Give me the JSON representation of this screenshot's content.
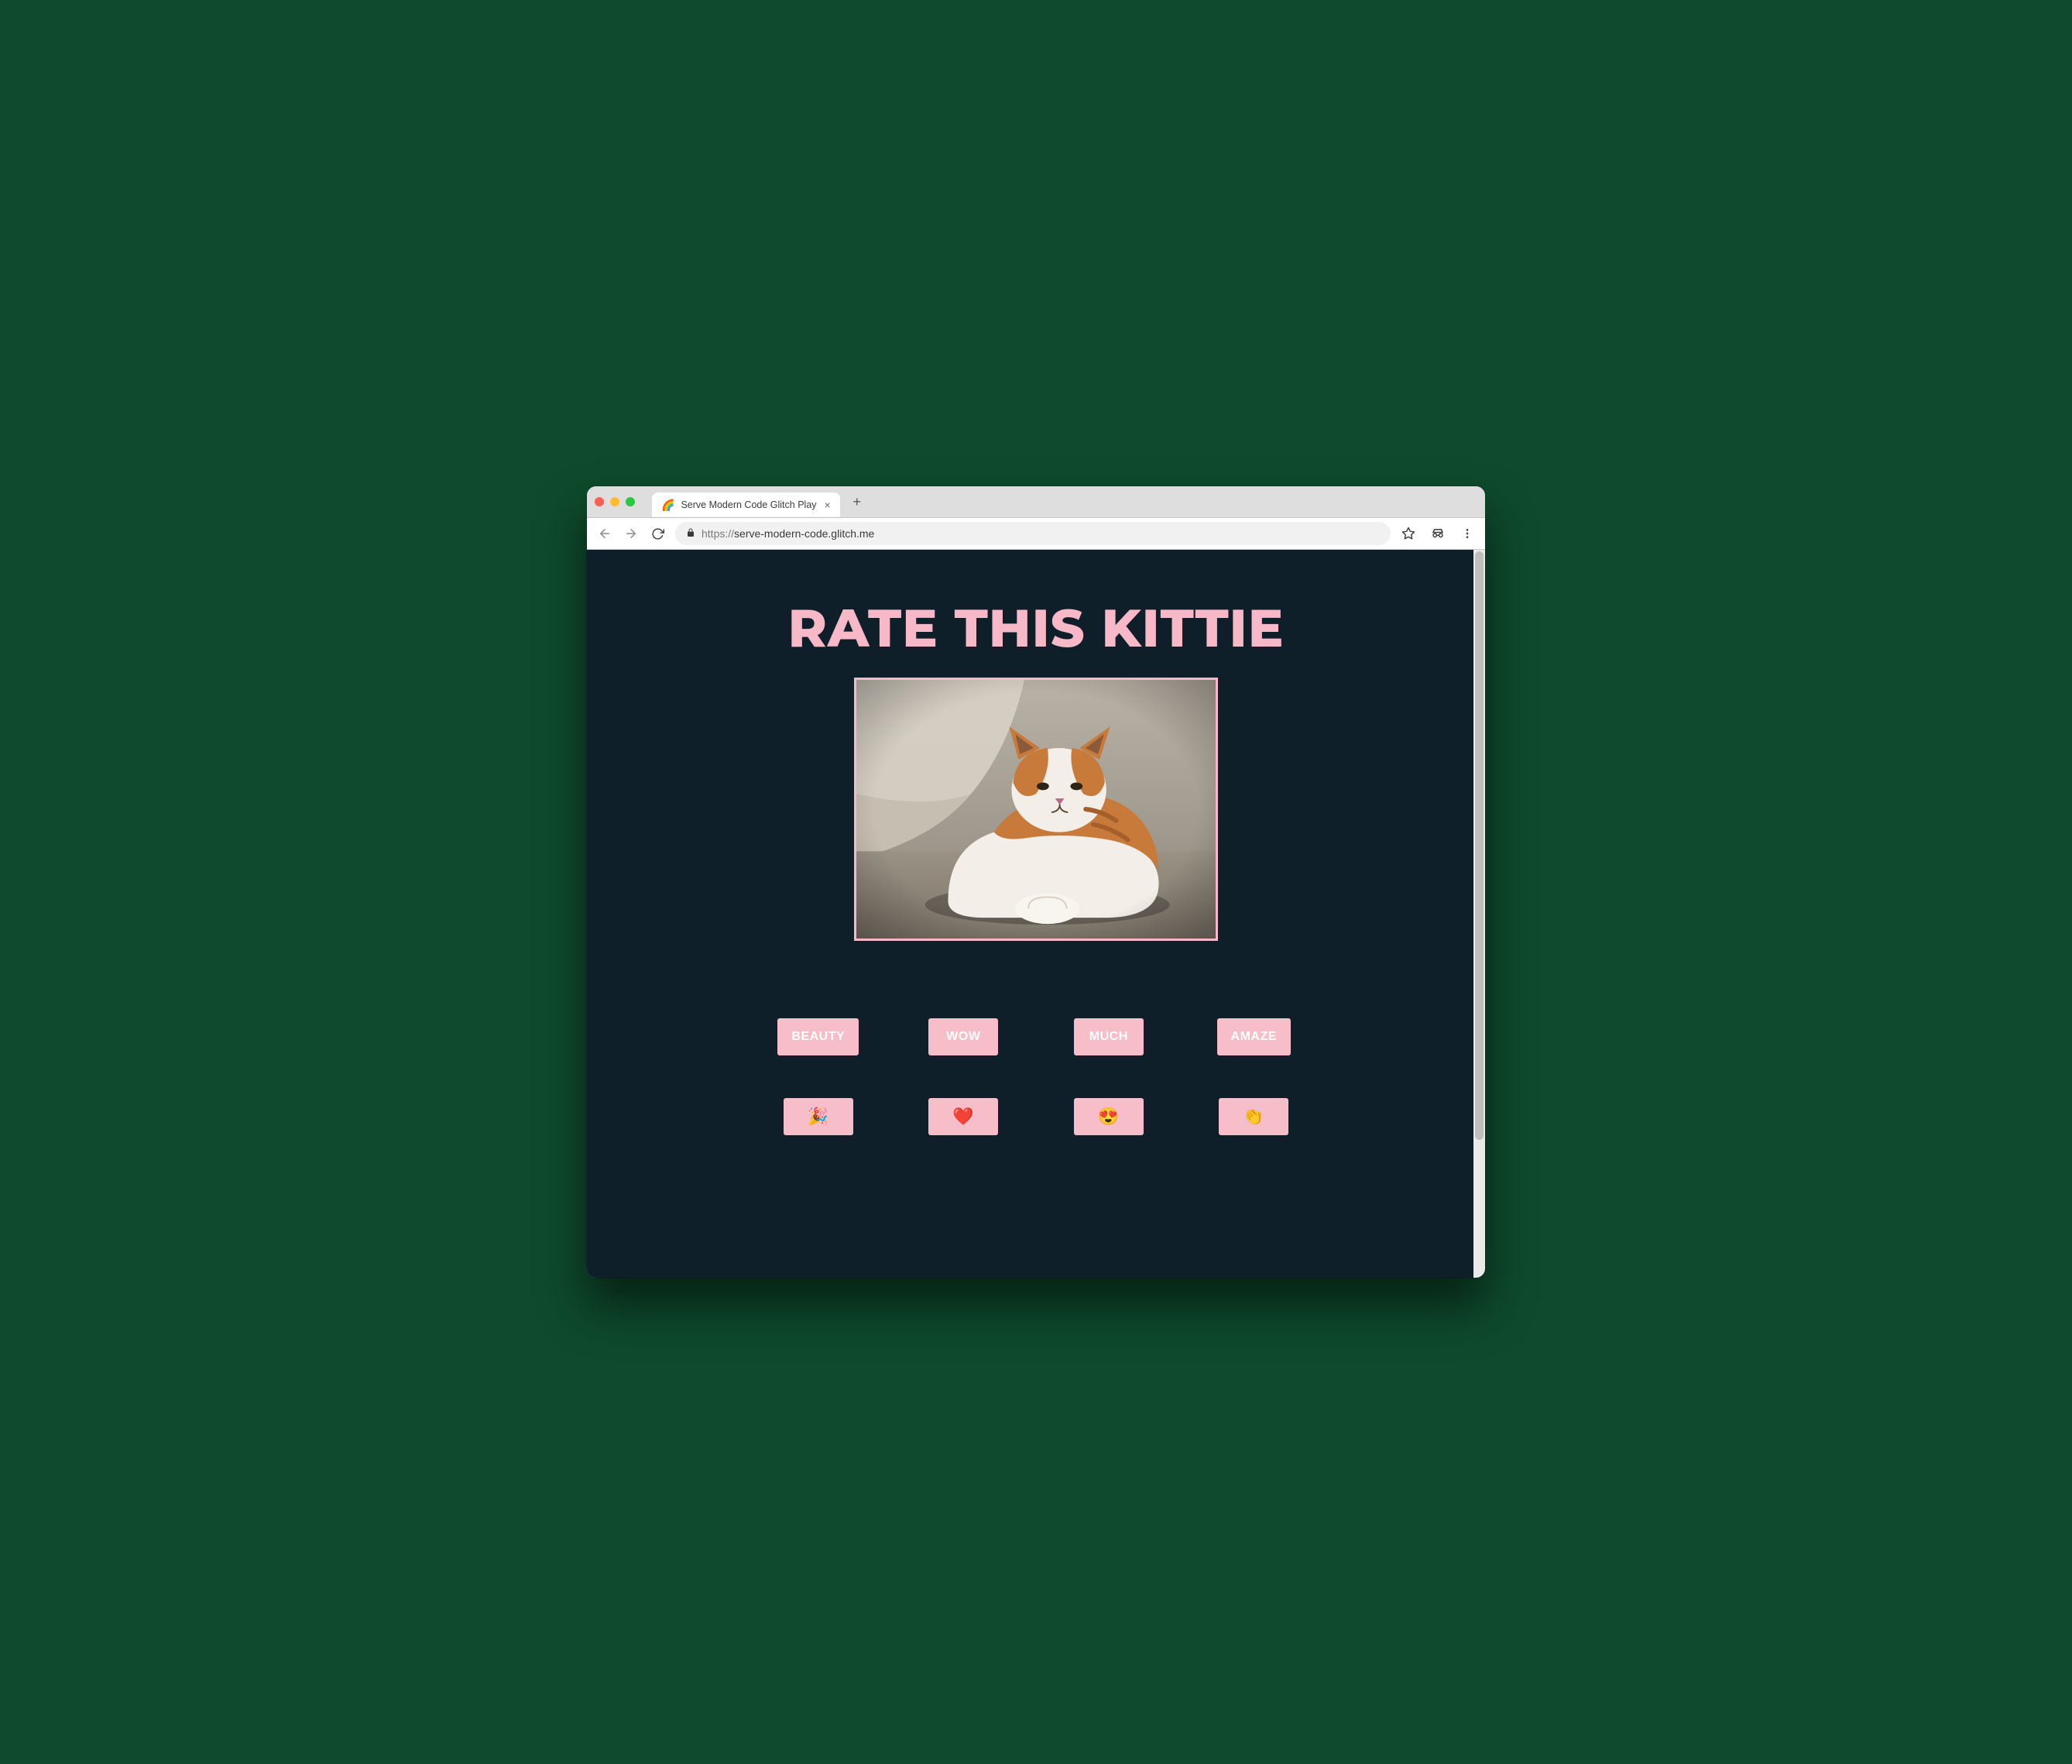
{
  "browser": {
    "tab_title": "Serve Modern Code Glitch Play",
    "tab_favicon": "🌈",
    "url_scheme": "https://",
    "url_rest": "serve-modern-code.glitch.me"
  },
  "page": {
    "heading": "RATE THIS KITTIE",
    "image_alt": "An orange and white cat lying on the floor looking unimpressed",
    "text_buttons": [
      "BEAUTY",
      "WOW",
      "MUCH",
      "AMAZE"
    ],
    "emoji_buttons": [
      "🎉",
      "❤️",
      "😍",
      "👏"
    ]
  },
  "colors": {
    "page_background": "#0f1f2a",
    "accent_pink": "#f7b8c8",
    "button_pink": "#f7bec9",
    "button_text": "#ffffff"
  }
}
